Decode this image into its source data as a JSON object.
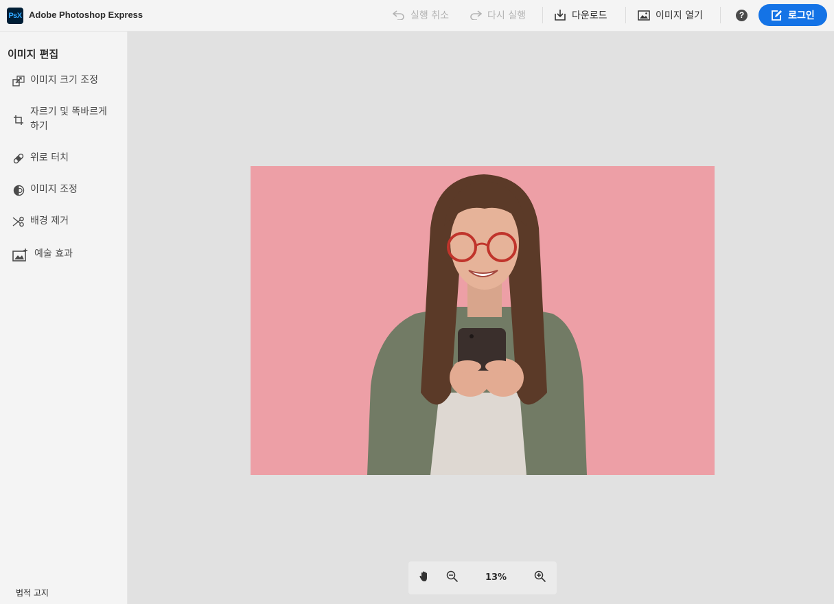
{
  "header": {
    "logo_text": "PsX",
    "app_title": "Adobe Photoshop Express",
    "undo_label": "실행 취소",
    "redo_label": "다시 실행",
    "download_label": "다운로드",
    "open_image_label": "이미지 열기",
    "help_icon": "?",
    "login_label": "로그인"
  },
  "sidebar": {
    "title": "이미지 편집",
    "items": [
      {
        "label": "이미지 크기 조정",
        "icon": "resize-icon"
      },
      {
        "label": "자르기 및 똑바르게 하기",
        "icon": "crop-icon"
      },
      {
        "label": "위로 터치",
        "icon": "bandage-icon"
      },
      {
        "label": "이미지 조정",
        "icon": "adjust-icon"
      },
      {
        "label": "배경 제거",
        "icon": "scissors-icon"
      },
      {
        "label": "예술 효과",
        "icon": "art-effects-icon"
      }
    ],
    "legal_label": "법적 고지"
  },
  "canvas": {
    "background_color": "#ed9fa6"
  },
  "zoom": {
    "level": "13%"
  },
  "colors": {
    "accent": "#1473e6",
    "disabled_text": "#b3b3b3"
  }
}
